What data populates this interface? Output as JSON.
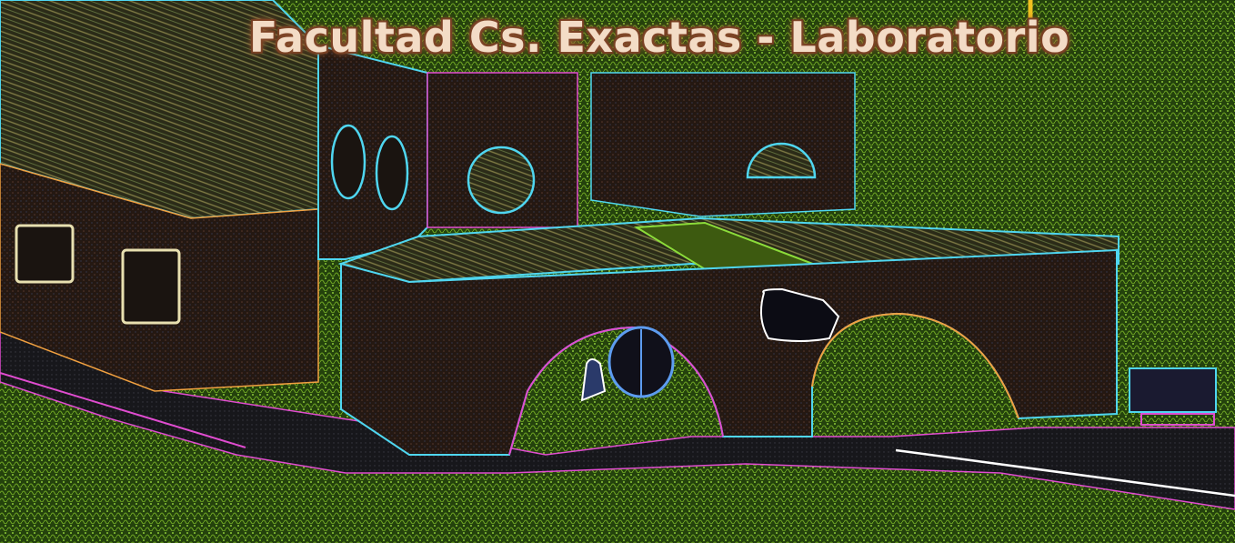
{
  "caption": {
    "text": "Facultad Cs. Exactas - Laboratorio"
  },
  "colors": {
    "grass": "#2f5a12",
    "grass_light": "#5a8f1c",
    "wall": "#2a1c16",
    "roof": "#3a3a22",
    "path": "#1e1e22",
    "edge_cyan": "#4fd6f0",
    "edge_magenta": "#e04cd0",
    "edge_orange": "#f0a040",
    "edge_white": "#ffffff",
    "caption_fill": "#f3dcc6",
    "caption_glow": "#8a4e2e"
  },
  "effect": "edge-detection / neon glow filter"
}
